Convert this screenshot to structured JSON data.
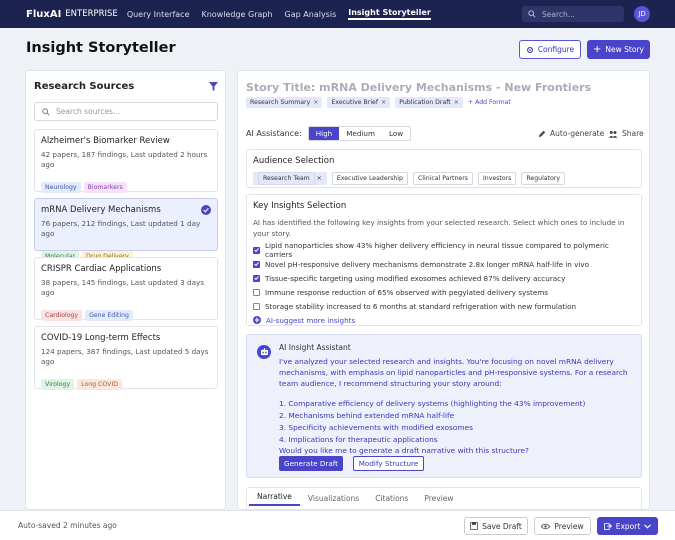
{
  "nav": {
    "brand": "FluxAI",
    "brand_sub": "ENTERPRISE",
    "links": [
      "Query Interface",
      "Knowledge Graph",
      "Gap Analysis",
      "Insight Storyteller"
    ],
    "search_placeholder": "Search...",
    "avatar": "JD"
  },
  "header": {
    "title": "Insight Storyteller",
    "configure": "Configure",
    "new_story": "New Story"
  },
  "sources": {
    "title": "Research Sources",
    "search_placeholder": "Search sources...",
    "items": [
      {
        "title": "Alzheimer's Biomarker Review",
        "meta": "42 papers, 187 findings, Last updated 2 hours ago",
        "tags": [
          "Neurology",
          "Biomarkers"
        ],
        "selected": false
      },
      {
        "title": "mRNA Delivery Mechanisms",
        "meta": "76 papers, 212 findings, Last updated 1 day ago",
        "tags": [
          "Molecular",
          "Drug Delivery"
        ],
        "selected": true
      },
      {
        "title": "CRISPR Cardiac Applications",
        "meta": "38 papers, 145 findings, Last updated 3 days ago",
        "tags": [
          "Cardiology",
          "Gene Editing"
        ],
        "selected": false
      },
      {
        "title": "COVID-19 Long-term Effects",
        "meta": "124 papers, 387 findings, Last updated 5 days ago",
        "tags": [
          "Virology",
          "Long COVID"
        ],
        "selected": false
      }
    ]
  },
  "story": {
    "title": "Story Title: mRNA Delivery Mechanisms - New Frontiers",
    "formats": [
      "Research Summary",
      "Executive Brief",
      "Publication Draft"
    ],
    "add_format": "+ Add Format",
    "ai_label": "AI Assistance:",
    "ai_levels": [
      "High",
      "Medium",
      "Low"
    ],
    "auto_generate": "Auto-generate",
    "share": "Share"
  },
  "audience": {
    "title": "Audience Selection",
    "options": [
      "Research Team",
      "Executive Leadership",
      "Clinical Partners",
      "Investors",
      "Regulatory"
    ]
  },
  "insights": {
    "title": "Key Insights Selection",
    "desc": "AI has identified the following key insights from your selected research. Select which ones to include in your story.",
    "items": [
      {
        "text": "Lipid nanoparticles show 43% higher delivery efficiency in neural tissue compared to polymeric carriers",
        "checked": true
      },
      {
        "text": "Novel pH-responsive delivery mechanisms demonstrate 2.8x longer mRNA half-life in vivo",
        "checked": true
      },
      {
        "text": "Tissue-specific targeting using modified exosomes achieved 87% delivery accuracy",
        "checked": true
      },
      {
        "text": "Immune response reduction of 65% observed with pegylated delivery systems",
        "checked": false
      },
      {
        "text": "Storage stability increased to 6 months at standard refrigeration with new formulation",
        "checked": false
      }
    ],
    "suggest": "AI-suggest more insights"
  },
  "assistant": {
    "title": "AI Insight Assistant",
    "message": "I've analyzed your selected research and insights. You're focusing on novel mRNA delivery mechanisms, with emphasis on lipid nanoparticles and pH-responsive systems. For a research team audience, I recommend structuring your story around:",
    "steps": [
      "1. Comparative efficiency of delivery systems (highlighting the 43% improvement)",
      "2. Mechanisms behind extended mRNA half-life",
      "3. Specificity achievements with modified exosomes",
      "4. Implications for therapeutic applications"
    ],
    "question": "Would you like me to generate a draft narrative with this structure?",
    "generate": "Generate Draft",
    "modify": "Modify Structure"
  },
  "tabs": [
    "Narrative",
    "Visualizations",
    "Citations",
    "Preview"
  ],
  "footer": {
    "saved": "Auto-saved 2 minutes ago",
    "save_draft": "Save Draft",
    "preview": "Preview",
    "export": "Export"
  },
  "colors": {
    "accent": "#4a45c8",
    "nav_bg": "#1c2350"
  }
}
